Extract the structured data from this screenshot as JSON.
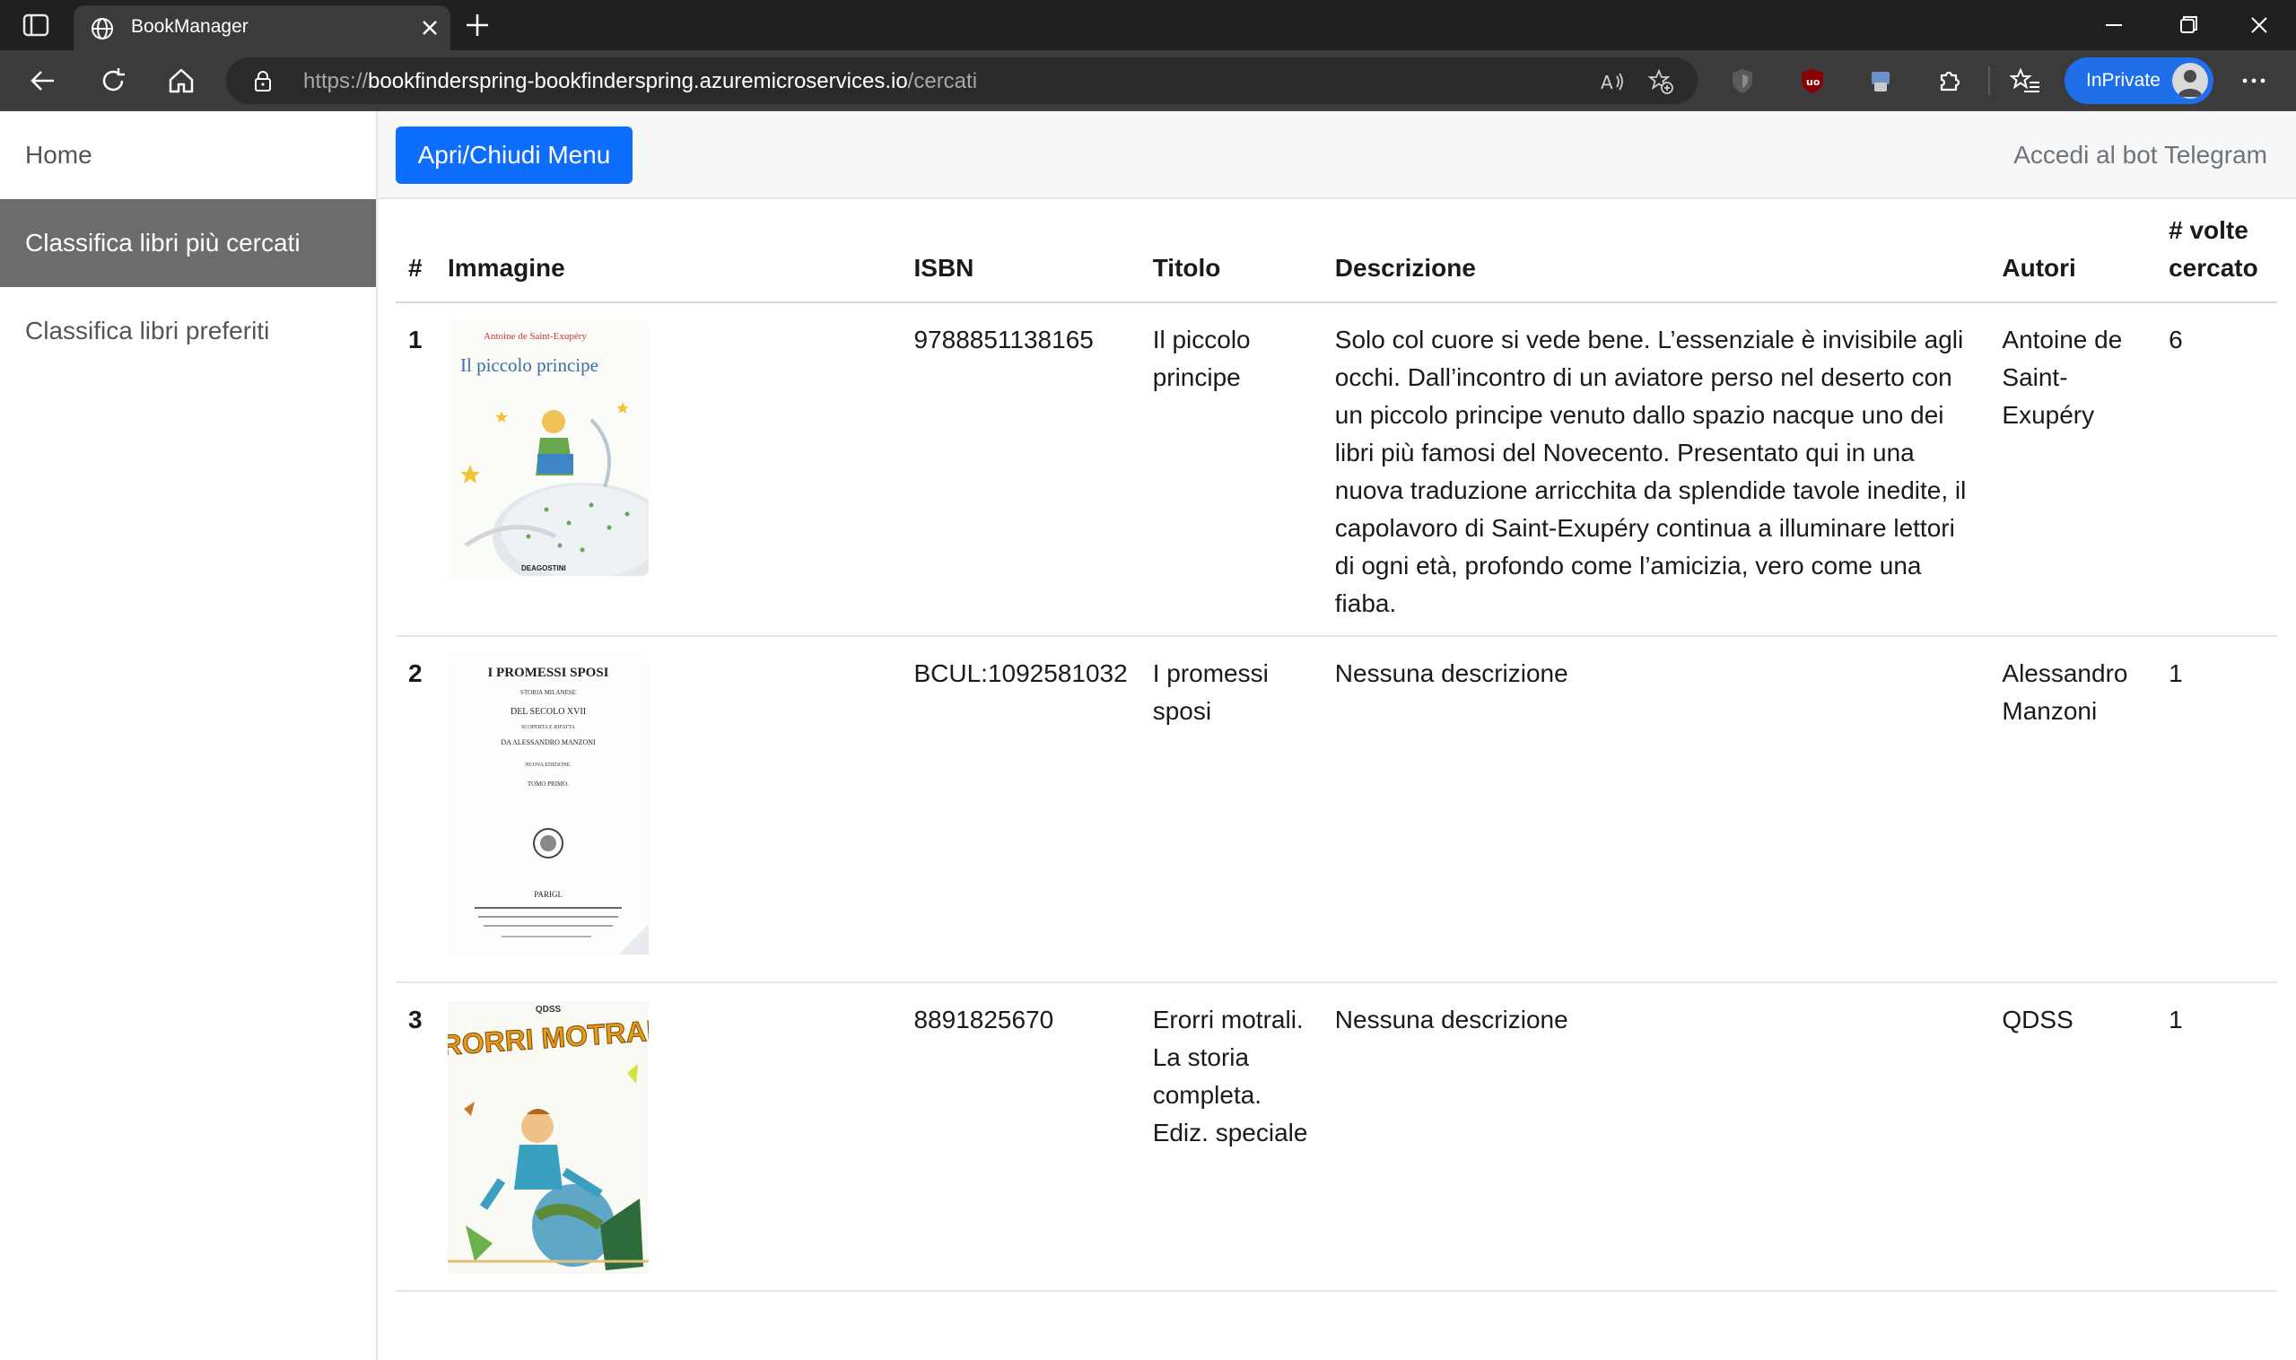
{
  "browser": {
    "tab_title": "BookManager",
    "url_host": "https://bookfinderspring-bookfinderspring.azuremicroservices.io",
    "url_path": "/cercati",
    "inprivate_label": "InPrivate",
    "colors": {
      "frame": "#202020",
      "toolbar": "#3b3b3b",
      "inprivate": "#1f6feb"
    }
  },
  "sidebar": {
    "items": [
      {
        "label": "Home",
        "active": false
      },
      {
        "label": "Classifica libri più cercati",
        "active": true
      },
      {
        "label": "Classifica libri preferiti",
        "active": false
      }
    ]
  },
  "topnav": {
    "menu_button": "Apri/Chiudi Menu",
    "telegram_link": "Accedi al bot Telegram",
    "accent": "#0d6efd"
  },
  "table": {
    "headers": [
      "#",
      "Immagine",
      "ISBN",
      "Titolo",
      "Descrizione",
      "Autori",
      "# volte cercato"
    ],
    "rows": [
      {
        "rank": "1",
        "cover_title": "Il piccolo principe",
        "cover_author": "Antoine de Saint-Exupéry",
        "cover_publisher": "DEAGOSTINI",
        "isbn": "9788851138165",
        "title": "Il piccolo principe",
        "description": "Solo col cuore si vede bene. L’essenziale è invisibile agli occhi. Dall’incontro di un aviatore perso nel deserto con un piccolo principe venuto dallo spazio nacque uno dei libri più famosi del Novecento. Presentato qui in una nuova traduzione arricchita da splendide tavole inedite, il capolavoro di Saint-Exupéry continua a illuminare lettori di ogni età, profondo come l’amicizia, vero come una fiaba.",
        "authors": "Antoine de Saint-Exupéry",
        "times": "6"
      },
      {
        "rank": "2",
        "cover_title": "I PROMESSI SPOSI",
        "cover_lines": [
          "STORIA MILANESE",
          "DEL SECOLO XVII",
          "SCOPERTA E RIFATTA",
          "DA ALESSANDRO MANZONI",
          "NUOVA EDIZIONE.",
          "TOMO PRIMO.",
          "PARIGI."
        ],
        "isbn": "BCUL:1092581032",
        "title": "I promessi sposi",
        "description": "Nessuna descrizione",
        "authors": "Alessandro Manzoni",
        "times": "1"
      },
      {
        "rank": "3",
        "cover_title": "ERORRI MOTRALI",
        "cover_brand": "QDSS",
        "isbn": "8891825670",
        "title": "Erorri motrali. La storia completa. Ediz. speciale",
        "description": "Nessuna descrizione",
        "authors": "QDSS",
        "times": "1"
      }
    ]
  }
}
